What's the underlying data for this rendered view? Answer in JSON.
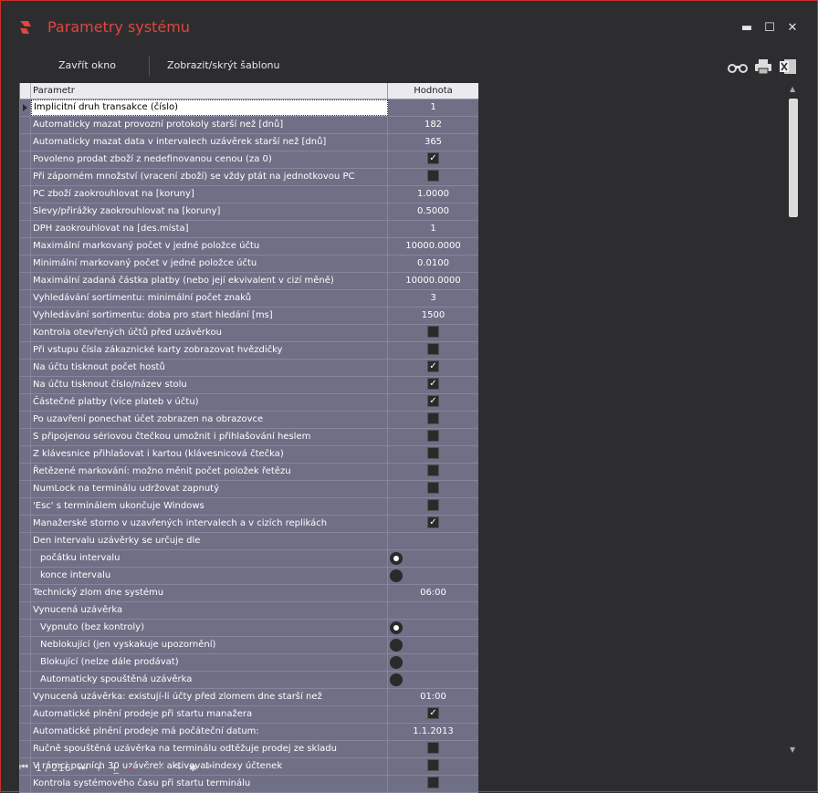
{
  "window": {
    "title": "Parametry systému",
    "minimize": "▬",
    "maximize": "☐",
    "close": "✕"
  },
  "toolbar": {
    "close_label": "Zavřít okno",
    "template_label": "Zobrazit/skrýt šablonu",
    "icons": [
      "binoculars-icon",
      "printer-icon",
      "excel-icon"
    ]
  },
  "grid": {
    "col_param": "Parametr",
    "col_value": "Hodnota",
    "rows": [
      {
        "label": "Implicitní druh transakce (číslo)",
        "value": "1",
        "type": "text",
        "selected": true
      },
      {
        "label": "Automaticky mazat provozní protokoly starší než [dnů]",
        "value": "182",
        "type": "text"
      },
      {
        "label": "Automaticky mazat data v intervalech uzávěrek starší než [dnů]",
        "value": "365",
        "type": "text"
      },
      {
        "label": "Povoleno prodat zboží z nedefinovanou cenou (za 0)",
        "type": "check",
        "checked": true
      },
      {
        "label": "Při záporném množství (vracení zboží) se vždy ptát na jednotkovou PC",
        "type": "check",
        "checked": false
      },
      {
        "label": "PC zboží zaokrouhlovat na [koruny]",
        "value": "1.0000",
        "type": "text"
      },
      {
        "label": "Slevy/přirážky zaokrouhlovat na [koruny]",
        "value": "0.5000",
        "type": "text"
      },
      {
        "label": "DPH zaokrouhlovat na [des.místa]",
        "value": "1",
        "type": "text"
      },
      {
        "label": "Maximální markovaný počet v jedné položce účtu",
        "value": "10000.0000",
        "type": "text"
      },
      {
        "label": "Minimální markovaný počet v jedné položce účtu",
        "value": "0.0100",
        "type": "text"
      },
      {
        "label": "Maximální zadaná částka platby (nebo její ekvivalent v cizí měně)",
        "value": "10000.0000",
        "type": "text"
      },
      {
        "label": "Vyhledávání sortimentu: minimální počet znaků",
        "value": "3",
        "type": "text"
      },
      {
        "label": "Vyhledávání sortimentu: doba pro start hledání [ms]",
        "value": "1500",
        "type": "text"
      },
      {
        "label": "Kontrola otevřených účtů před uzávěrkou",
        "type": "check",
        "checked": false
      },
      {
        "label": "Při vstupu čísla zákaznické karty zobrazovat hvězdičky",
        "type": "check",
        "checked": false
      },
      {
        "label": "Na účtu tisknout počet hostů",
        "type": "check",
        "checked": true
      },
      {
        "label": "Na účtu tisknout číslo/název stolu",
        "type": "check",
        "checked": true
      },
      {
        "label": "Částečné platby (více plateb v účtu)",
        "type": "check",
        "checked": true
      },
      {
        "label": "Po uzavření ponechat účet zobrazen na obrazovce",
        "type": "check",
        "checked": false
      },
      {
        "label": "S připojenou sériovou čtečkou umožnit i přihlašování heslem",
        "type": "check",
        "checked": false
      },
      {
        "label": "Z klávesnice přihlašovat i kartou (klávesnicová čtečka)",
        "type": "check",
        "checked": false
      },
      {
        "label": "Řetězené markování: možno měnit počet položek řetězu",
        "type": "check",
        "checked": false
      },
      {
        "label": "NumLock na terminálu udržovat zapnutý",
        "type": "check",
        "checked": false
      },
      {
        "label": "'Esc' s terminálem ukončuje Windows",
        "type": "check",
        "checked": false
      },
      {
        "label": "Manažerské storno v uzavřených intervalech a v cizích replikách",
        "type": "check",
        "checked": true
      },
      {
        "label": "Den intervalu uzávěrky se určuje dle",
        "type": "none"
      },
      {
        "label": "počátku intervalu",
        "type": "radio",
        "checked": true,
        "indent": true
      },
      {
        "label": "konce intervalu",
        "type": "radio",
        "checked": false,
        "indent": true
      },
      {
        "label": "Technický zlom dne systému",
        "value": "06:00",
        "type": "text"
      },
      {
        "label": "Vynucená uzávěrka",
        "type": "none"
      },
      {
        "label": "Vypnuto (bez kontroly)",
        "type": "radio",
        "checked": true,
        "indent": true
      },
      {
        "label": "Neblokující (jen vyskakuje upozornění)",
        "type": "radio",
        "checked": false,
        "indent": true
      },
      {
        "label": "Blokující (nelze dále prodávat)",
        "type": "radio",
        "checked": false,
        "indent": true
      },
      {
        "label": "Automaticky spouštěná uzávěrka",
        "type": "radio",
        "checked": false,
        "indent": true
      },
      {
        "label": "Vynucená uzávěrka: existují-li účty před zlomem dne starší než",
        "value": "01:00",
        "type": "text"
      },
      {
        "label": "Automatické plnění prodeje při startu manažera",
        "type": "check",
        "checked": true
      },
      {
        "label": "Automatické plnění prodeje má počáteční datum:",
        "value": "1.1.2013",
        "type": "text"
      },
      {
        "label": "Ručně spouštěná uzávěrka na terminálu odtěžuje prodej ze skladu",
        "type": "check",
        "checked": false
      },
      {
        "label": "V rámci prvních 30 uzávěrek aktivovat indexy účtenek",
        "type": "check",
        "checked": false
      },
      {
        "label": "Kontrola systémového času při startu terminálu",
        "type": "check",
        "checked": false
      }
    ]
  },
  "navigator": {
    "first": "⏮",
    "position": "1 / 216",
    "last": "⏭",
    "add": "+",
    "insert": "+̲",
    "delete": "−",
    "accept": "✔",
    "cancel": "✕",
    "refresh": "↷",
    "filter": "✱",
    "extra": "·*"
  }
}
